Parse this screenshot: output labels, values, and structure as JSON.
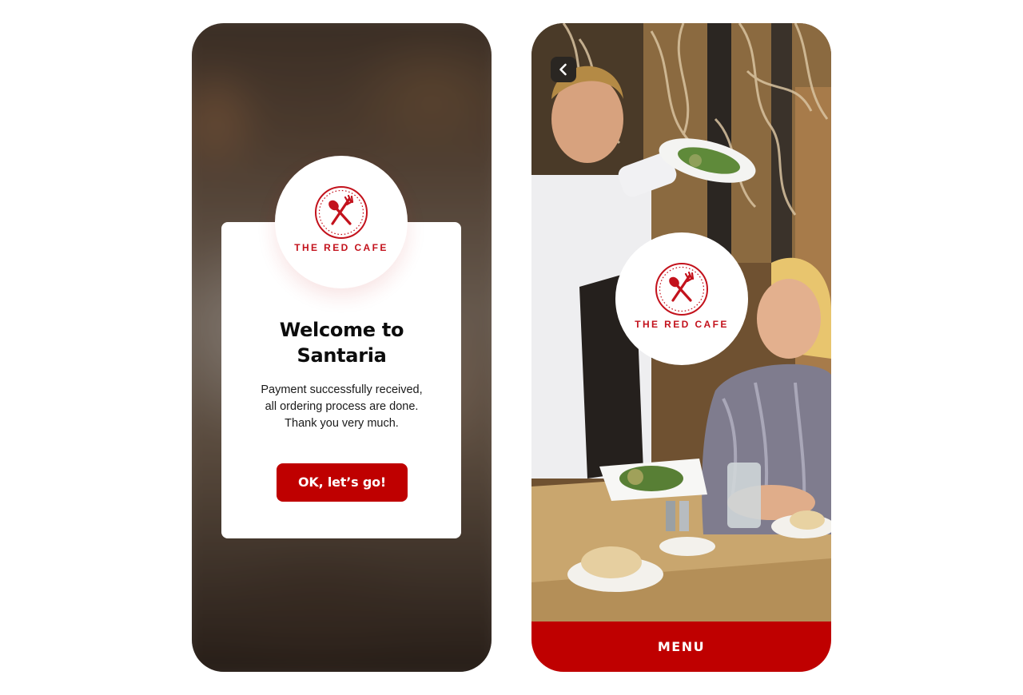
{
  "brand": {
    "logo_text": "THE RED CAFE",
    "primary_color": "#bf0000",
    "logo_color": "#c3121c",
    "logo_icon": "spoon-fork-crossed-icon"
  },
  "success_screen": {
    "title_line1": "Welcome to",
    "title_line2": "Santaria",
    "message_line1": "Payment successfully received,",
    "message_line2": "all ordering process are done.",
    "message_line3": "Thank you very much.",
    "button_label": "OK, let’s go!"
  },
  "home_screen": {
    "back_icon": "chevron-left-icon",
    "menu_label": "MENU"
  }
}
